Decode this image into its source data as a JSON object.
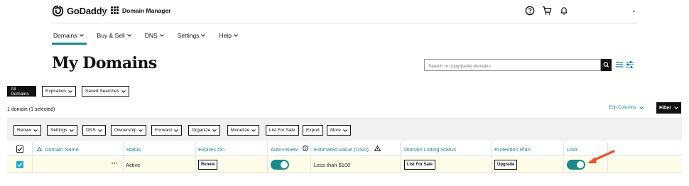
{
  "brand": {
    "name": "GoDaddy",
    "app": "Domain Manager"
  },
  "nav": [
    {
      "label": "Domains"
    },
    {
      "label": "Buy & Sell"
    },
    {
      "label": "DNS"
    },
    {
      "label": "Settings"
    },
    {
      "label": "Help"
    }
  ],
  "page_title": "My Domains",
  "search": {
    "placeholder": "Search or copy/paste domains"
  },
  "filters": {
    "all": "All Domains",
    "expiration": "Expiration",
    "saved": "Saved Searches"
  },
  "selection_count": "1 domain (1 selected)",
  "edit_columns": "Edit Columns",
  "filter_button": "Filter",
  "actions": [
    "Renew",
    "Settings",
    "DNS",
    "Ownership",
    "Forward",
    "Organize",
    "Monetize",
    "List For Sale",
    "Export",
    "More"
  ],
  "table": {
    "headers": {
      "domain": "Domain Name",
      "status": "Status",
      "expires": "Expires On",
      "autorenew": "Auto-renew",
      "value": "Estimated Value (USD)",
      "listing": "Domain Listing Status",
      "protection": "Protection Plan",
      "lock": "Lock"
    },
    "row": {
      "status": "Active",
      "renew_btn": "Renew",
      "autorenew_on": true,
      "value": "Less than $100",
      "listing_btn": "List For Sale",
      "protection_btn": "Upgrade",
      "lock_on": true
    }
  },
  "colors": {
    "accent": "#1b8a8a",
    "link": "#1b7f9a",
    "arrow": "#e8542e",
    "row_highlight": "#fffbe9"
  }
}
